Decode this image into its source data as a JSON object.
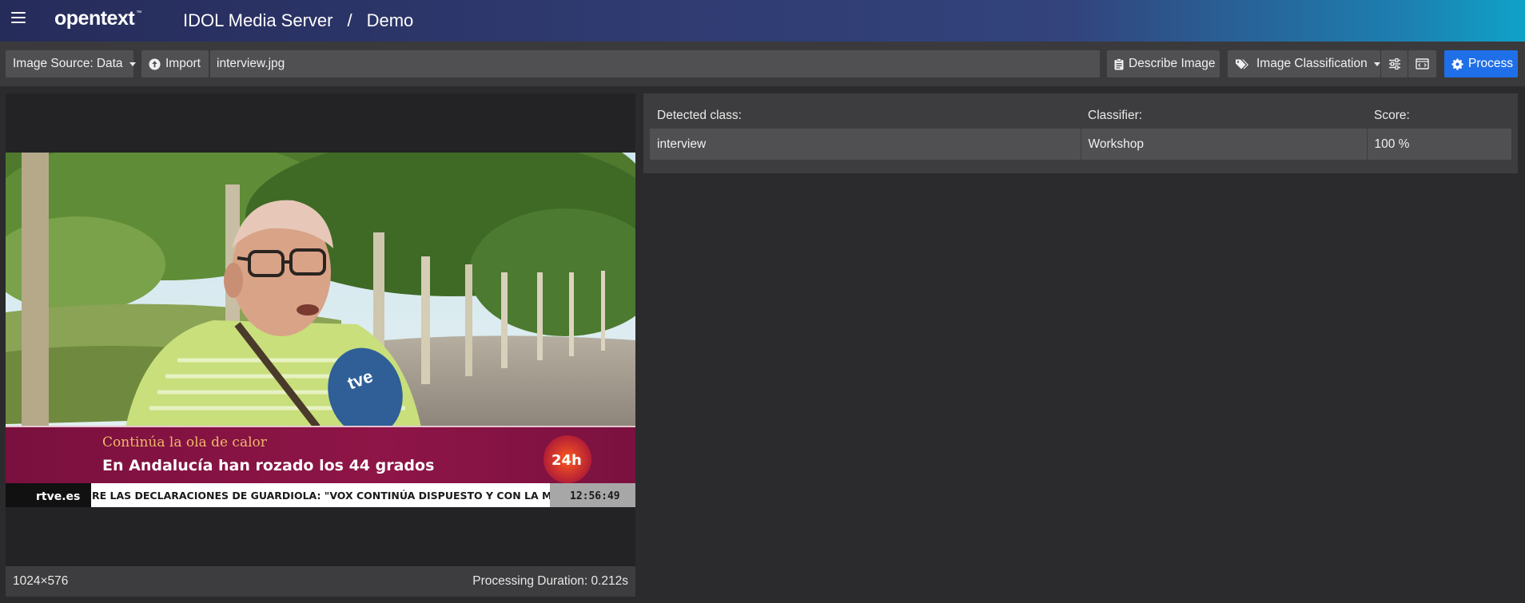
{
  "header": {
    "logo": "opentext",
    "logo_tm": "™",
    "app_name": "IDOL Media Server",
    "separator": "/",
    "page": "Demo"
  },
  "toolbar": {
    "image_source_label": "Image Source:",
    "image_source_value": "Data",
    "import_label": "Import",
    "file_name": "interview.jpg",
    "describe_label": "Describe Image",
    "classification_label": "Image Classification",
    "process_label": "Process"
  },
  "image": {
    "overlay_line1": "Continúa la ola de calor",
    "overlay_line2": "En Andalucía han rozado los 44 grados",
    "channel_badge": "24h",
    "ticker_brand": "rtve.es",
    "ticker_text": "RE LAS DECLARACIONES DE GUARDIOLA: \"VOX CONTINÚA DISPUESTO Y CON LA M",
    "ticker_time": "12:56:49",
    "mic_brand": "tve"
  },
  "footer": {
    "dimensions": "1024×576",
    "duration_label": "Processing Duration:",
    "duration_value": "0.212s"
  },
  "results": {
    "headers": [
      "Detected class:",
      "Classifier:",
      "Score:"
    ],
    "rows": [
      [
        "interview",
        "Workshop",
        "100 %"
      ]
    ]
  },
  "colors": {
    "accent": "#1f6fe8",
    "header_start": "#262c5a",
    "header_end": "#0fa2c8",
    "banner": "#8e1547",
    "banner_title": "#f0b86a"
  }
}
